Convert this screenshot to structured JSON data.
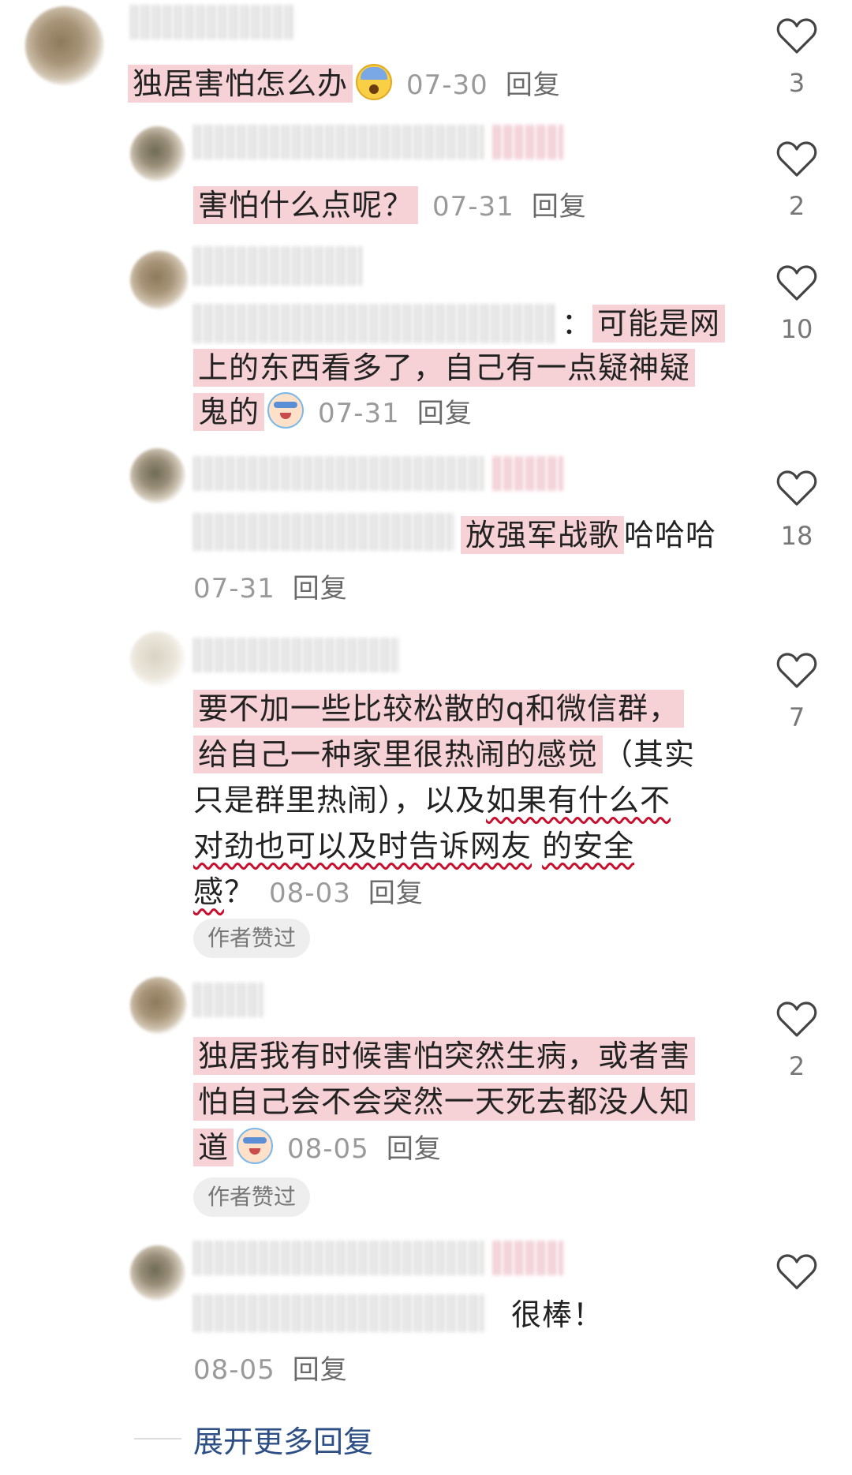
{
  "comments": [
    {
      "text": "独居害怕怎么办",
      "emoji": "fearful-face",
      "date": "07-30",
      "reply": "回复",
      "likes": "3"
    },
    {
      "text": "害怕什么点呢？",
      "date": "07-31",
      "reply": "回复",
      "likes": "2"
    },
    {
      "prefix": "：",
      "text_line1": "可能是网",
      "text_line2": "上的东西看多了，自己有一点疑神疑",
      "text_line3": "鬼的",
      "emoji": "crying-face",
      "date": "07-31",
      "reply": "回复",
      "likes": "10"
    },
    {
      "text_hl": "放强军战歌",
      "text_rest": "哈哈哈",
      "date": "07-31",
      "reply": "回复",
      "likes": "18"
    },
    {
      "line1": "要不加一些比较松散的q和微信群，",
      "line2_hl": "给自己一种家里很热闹的感觉",
      "line2_rest": "（其实",
      "line3_a": "只是群里热闹），以及",
      "line3_b": "如果有什么不",
      "line4_a": "对劲也可以及时告诉网友",
      "line4_b": "的安全",
      "line5_a": "感",
      "line5_b": "？",
      "date": "08-03",
      "reply": "回复",
      "badge": "作者赞过",
      "likes": "7"
    },
    {
      "line1": "独居我有时候害怕突然生病，或者害",
      "line2": "怕自己会不会突然一天死去都没人知",
      "line3": "道",
      "emoji": "crying-face",
      "date": "08-05",
      "reply": "回复",
      "badge": "作者赞过",
      "likes": "2"
    },
    {
      "text": "很棒！",
      "date": "08-05",
      "reply": "回复",
      "likes": ""
    }
  ],
  "expand_more": "展开更多回复"
}
